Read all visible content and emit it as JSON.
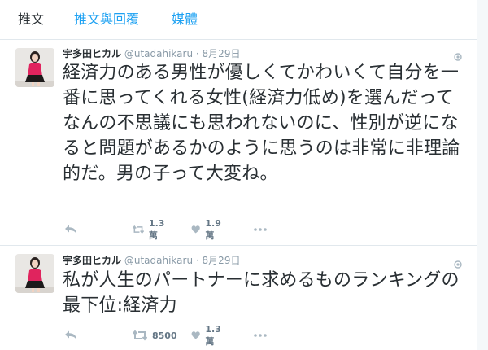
{
  "tabs": [
    "推文",
    "推文與回覆",
    "媒體"
  ],
  "tweets": [
    {
      "name": "宇多田ヒカル",
      "handle": "@utadahikaru",
      "sep": "·",
      "date": "8月29日",
      "text": "経済力のある男性が優しくてかわいくて自分を一番に思ってくれる女性(経済力低め)を選んだってなんの不思議にも思われないのに、性別が逆になると問題があるかのように思うのは非常に非理論的だ。男の子って大変ね。",
      "retweets": "1.3萬",
      "likes": "1.9萬"
    },
    {
      "name": "宇多田ヒカル",
      "handle": "@utadahikaru",
      "sep": "·",
      "date": "8月29日",
      "text": "私が人生のパートナーに求めるものランキングの最下位:経済力",
      "retweets": "8500",
      "likes": "1.3萬"
    }
  ],
  "icons": {
    "reply": "reply-icon",
    "retweet": "retweet-icon",
    "like": "heart-icon",
    "more": "more-icon",
    "caret": "chevron-down-icon"
  },
  "colors": {
    "accent": "#1da1f2",
    "text": "#292f33",
    "muted": "#8899a6",
    "icon": "#aab8c2"
  }
}
